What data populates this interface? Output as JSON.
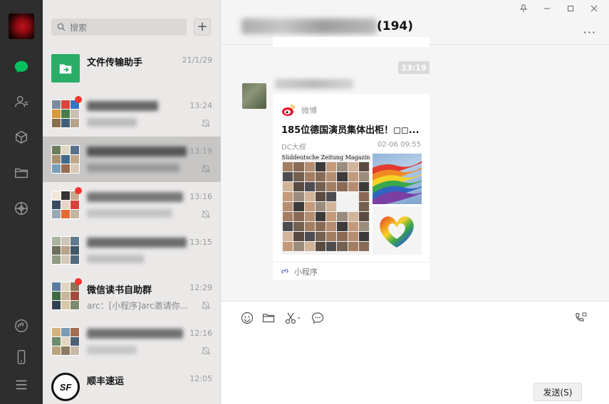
{
  "window": {
    "title_count": "(194)"
  },
  "search": {
    "placeholder": "搜索"
  },
  "list_actions": {
    "add": "+"
  },
  "conversations": [
    {
      "name": "文件传输助手",
      "time": "21/1/29",
      "preview": "",
      "unread": false,
      "muted": false,
      "avatar": "file-transfer-icon"
    },
    {
      "name": "",
      "time": "13:24",
      "preview": "",
      "unread": true,
      "muted": true
    },
    {
      "name": "",
      "time": "13:19",
      "preview": "",
      "unread": false,
      "muted": true,
      "active": true
    },
    {
      "name": "",
      "time": "13:16",
      "preview": "",
      "unread": true,
      "muted": true
    },
    {
      "name": "",
      "time": "13:15",
      "preview": "",
      "unread": false,
      "muted": false
    },
    {
      "name": "微信读书自助群",
      "time": "12:29",
      "preview": "arc：[小程序]arc邀请你...",
      "unread": true,
      "muted": true
    },
    {
      "name": "",
      "time": "12:16",
      "preview": "",
      "unread": false,
      "muted": true
    },
    {
      "name": "顺丰速运",
      "time": "12:05",
      "preview": "",
      "unread": false,
      "muted": false,
      "avatar": "sf-express-logo"
    }
  ],
  "chat": {
    "timestamp": "13:19",
    "card": {
      "source": "微博",
      "headline": "185位德国演员集体出柜！◻◻...",
      "author": "DC大叔",
      "date": "02-06 09:55",
      "magazine": "Süddeutsche Zeitung Magazin",
      "footer": "小程序"
    }
  },
  "input": {
    "send_label": "发送(S)"
  },
  "colors": {
    "nav_bg": "#2e2e2e",
    "list_bg": "#ebe9e8",
    "active_bg": "#c7c6c5",
    "unread_dot": "#f43530",
    "wechat_green": "#07c160"
  }
}
